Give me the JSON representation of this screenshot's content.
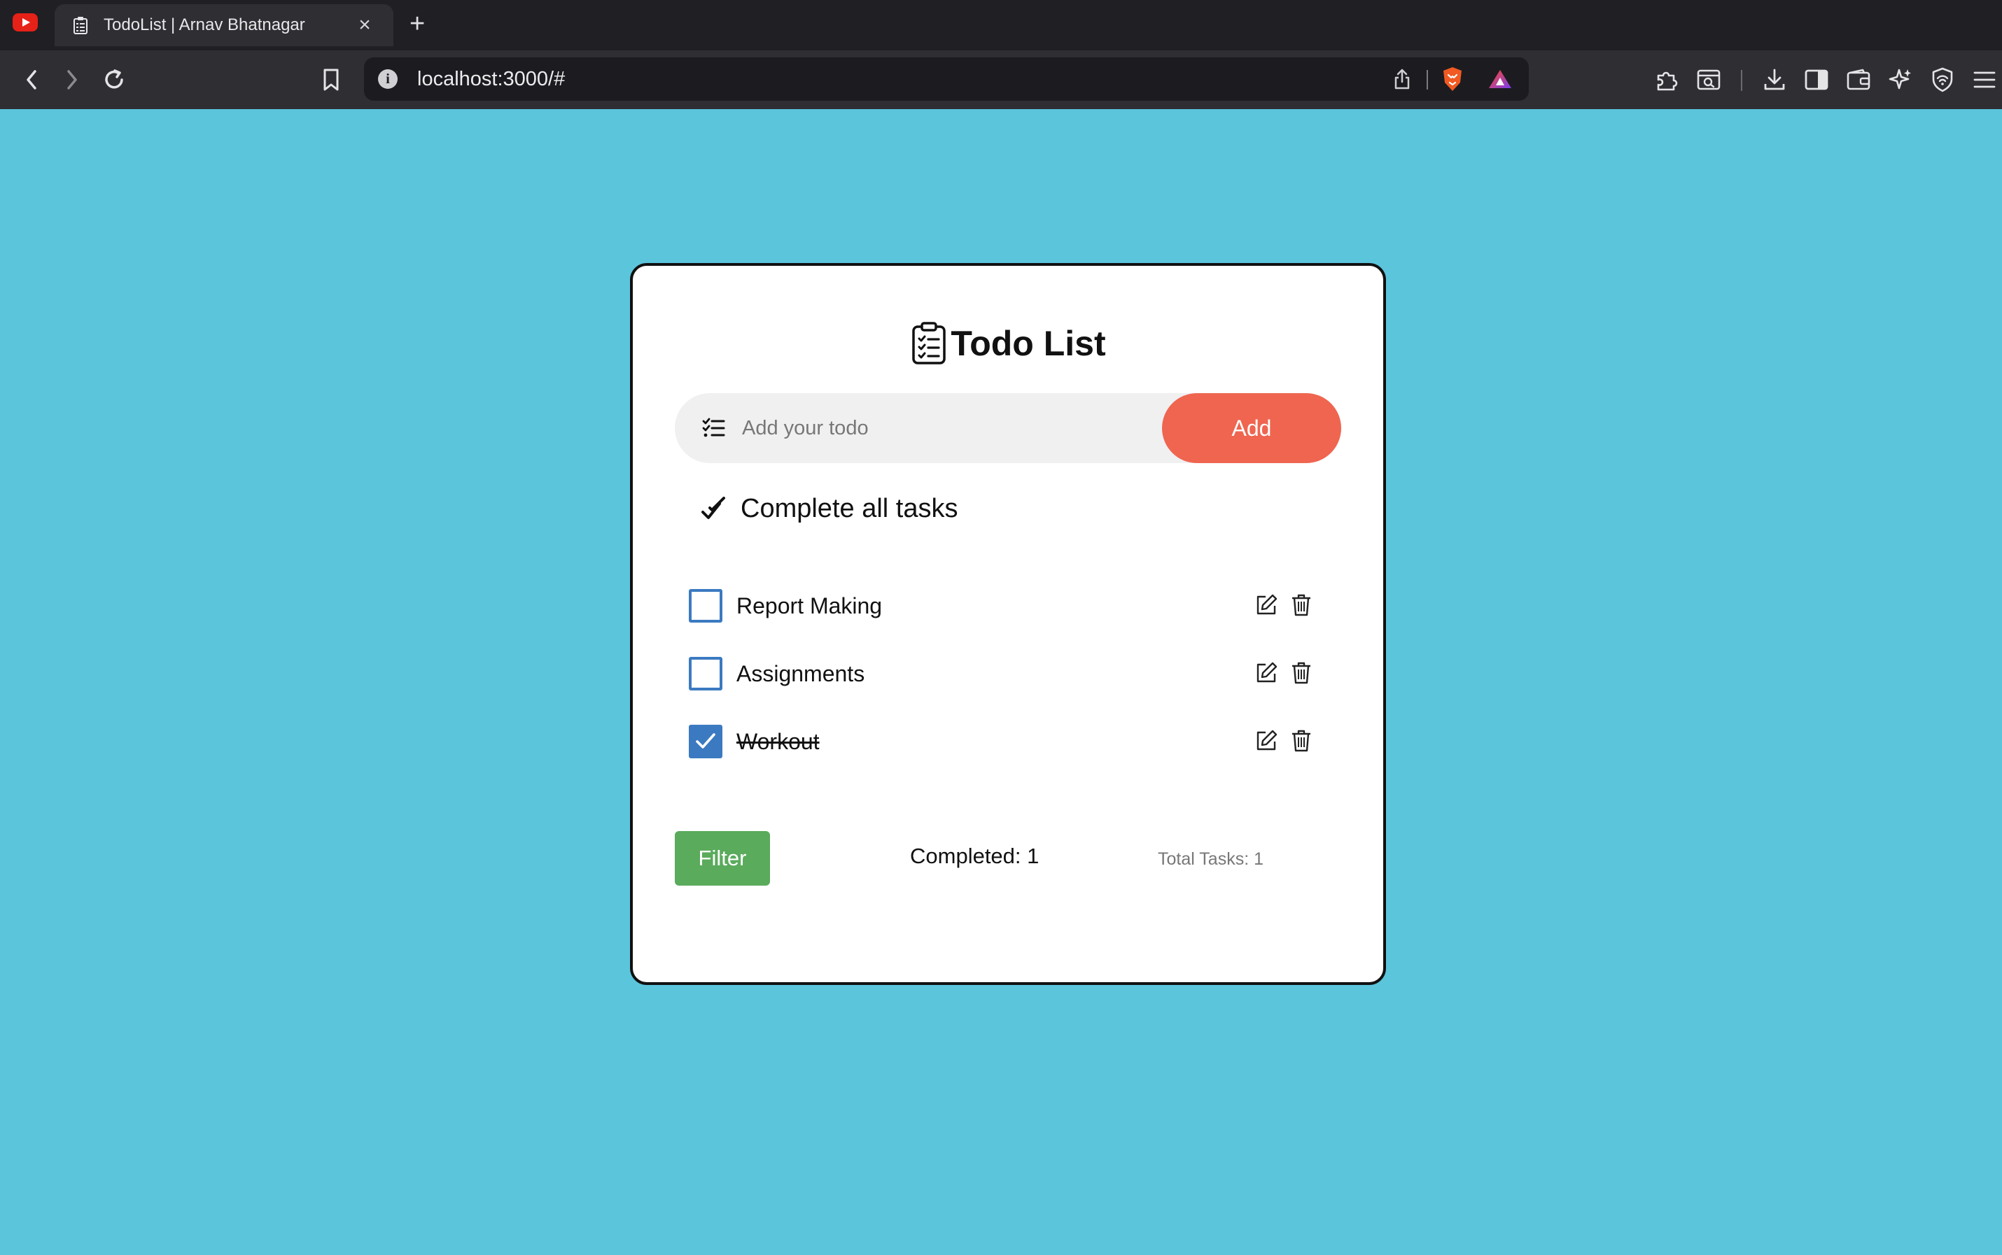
{
  "browser": {
    "tab_title": "TodoList | Arnav Bhatnagar",
    "tab_close": "×",
    "new_tab": "+",
    "url": "localhost:3000/#",
    "info_icon": "i"
  },
  "todo": {
    "title": "Todo List",
    "input_placeholder": "Add your todo",
    "input_value": "",
    "add_label": "Add",
    "complete_all_label": "Complete all tasks",
    "items": [
      {
        "label": "Report Making",
        "completed": false
      },
      {
        "label": "Assignments",
        "completed": false
      },
      {
        "label": "Workout",
        "completed": true
      }
    ],
    "filter_label": "Filter",
    "completed_text": "Completed: 1",
    "total_text": "Total Tasks: 1"
  },
  "colors": {
    "page_background": "#5bc5dc",
    "add_button": "#ef6550",
    "filter_button": "#5aab5c",
    "checkbox_accent": "#3b7ac1"
  }
}
